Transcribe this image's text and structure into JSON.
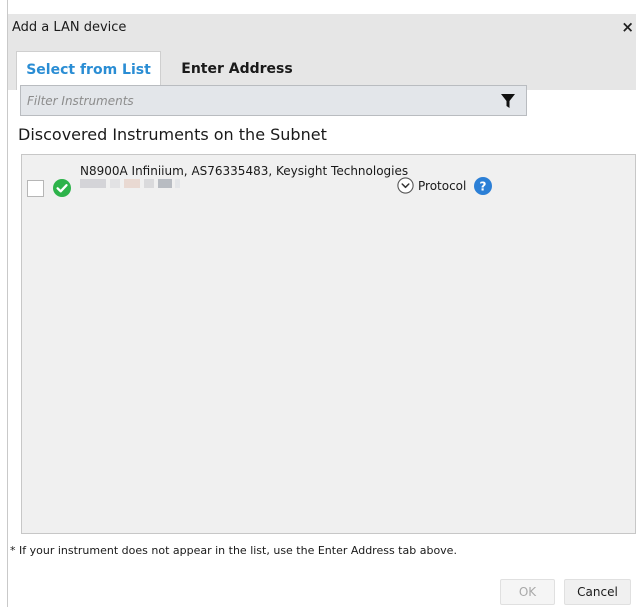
{
  "dialog": {
    "title": "Add a LAN device",
    "close_symbol": "×"
  },
  "tabs": [
    {
      "label": "Select from List",
      "active": true
    },
    {
      "label": "Enter Address",
      "active": false
    }
  ],
  "filter": {
    "placeholder": "Filter Instruments",
    "value": "",
    "icon": "filter-funnel-icon"
  },
  "section": {
    "heading": "Discovered Instruments on the Subnet"
  },
  "instruments": [
    {
      "name": "N8900A Infiniium, AS76335483, Keysight Technologies",
      "checked": false,
      "status_icon": "check-circle-icon",
      "status_color": "#2db34a",
      "address_redacted": true,
      "protocol_label": "Protocol",
      "protocol_icon": "chevron-down-circle-icon",
      "help_icon": "question-circle-icon"
    }
  ],
  "footnote": "* If your instrument does not appear in the list, use the Enter Address tab above.",
  "buttons": {
    "ok": "OK",
    "ok_enabled": false,
    "cancel": "Cancel"
  },
  "colors": {
    "accent": "#2a8dd4",
    "titlebar_bg": "#e6e6e6",
    "list_bg": "#f0f0f0",
    "help_blue": "#2b7fd6"
  }
}
